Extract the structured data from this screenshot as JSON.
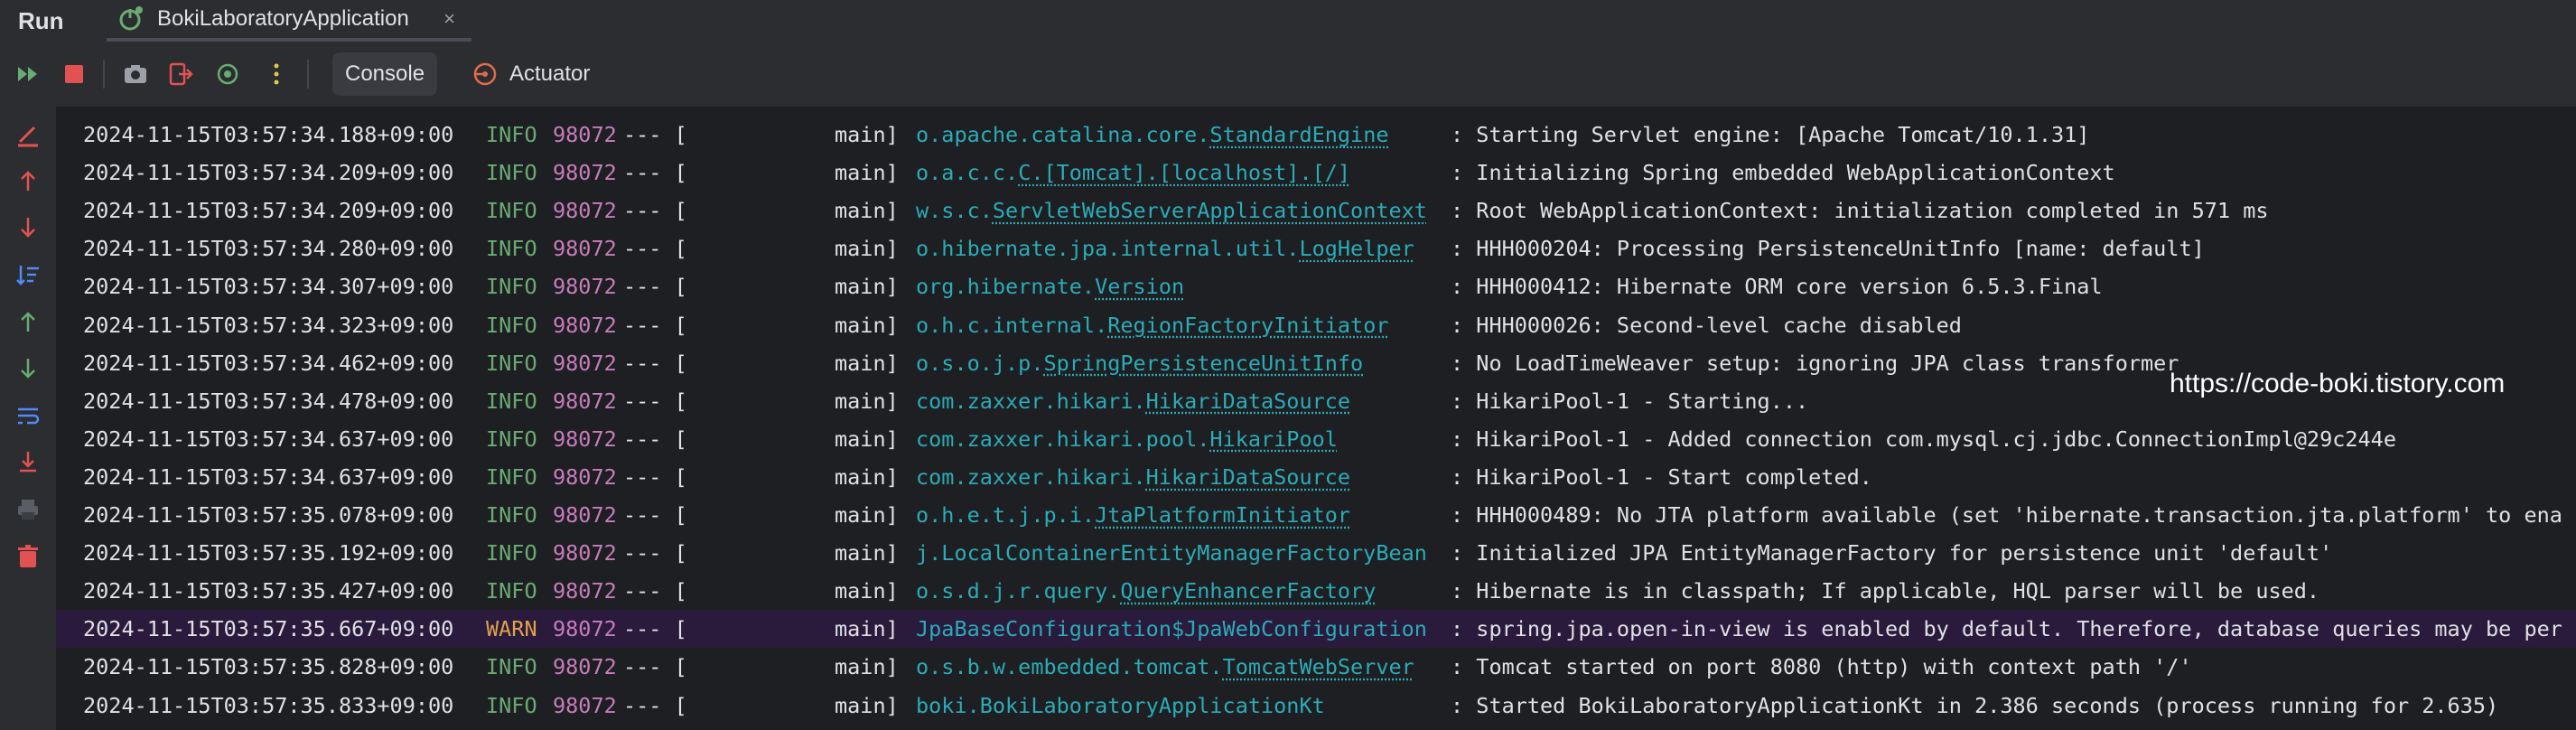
{
  "header": {
    "run_title": "Run",
    "tab_label": "BokiLaboratoryApplication",
    "tab_close": "×"
  },
  "toolbar": {
    "console_label": "Console",
    "actuator_label": "Actuator",
    "icons": [
      "rerun-icon",
      "stop-icon",
      "screenshot-icon",
      "exit-icon",
      "debug-icon",
      "more-icon"
    ]
  },
  "gutter_icons": [
    "clear-icon",
    "up-arrow-icon",
    "down-arrow-icon",
    "sort-icon",
    "up-icon",
    "down-icon",
    "soft-wrap-icon",
    "scroll-to-end-icon",
    "print-icon",
    "trash-icon"
  ],
  "watermark": "https://code-boki.tistory.com",
  "colors": {
    "background": "#1e1f22",
    "panel": "#2b2d30",
    "info": "#6aab73",
    "warn": "#e0a24a",
    "pid": "#c77dbb",
    "logger": "#2aacb8",
    "warn_row_bg": "#2a1a3c"
  },
  "log_rows": [
    {
      "ts": "2024-11-15T03:57:34.188+09:00",
      "level": "INFO",
      "pid": "98072",
      "sep": "--- [",
      "thread": "main]",
      "logger": "o.apache.catalina.core.StandardEngine",
      "logger_prefix": "o.apache.catalina.core.",
      "logger_class": "StandardEngine",
      "msg": ": Starting Servlet engine: [Apache Tomcat/10.1.31]"
    },
    {
      "ts": "2024-11-15T03:57:34.209+09:00",
      "level": "INFO",
      "pid": "98072",
      "sep": "--- [",
      "thread": "main]",
      "logger": "o.a.c.c.C.[Tomcat].[localhost].[/]",
      "logger_prefix": "o.a.c.c.",
      "logger_class": "C.[Tomcat].[localhost].[/]",
      "msg": ": Initializing Spring embedded WebApplicationContext"
    },
    {
      "ts": "2024-11-15T03:57:34.209+09:00",
      "level": "INFO",
      "pid": "98072",
      "sep": "--- [",
      "thread": "main]",
      "logger": "w.s.c.ServletWebServerApplicationContext",
      "logger_prefix": "w.s.c.",
      "logger_class": "ServletWebServerApplicationContext",
      "msg": ": Root WebApplicationContext: initialization completed in 571 ms"
    },
    {
      "ts": "2024-11-15T03:57:34.280+09:00",
      "level": "INFO",
      "pid": "98072",
      "sep": "--- [",
      "thread": "main]",
      "logger": "o.hibernate.jpa.internal.util.LogHelper",
      "logger_prefix": "o.hibernate.jpa.internal.util.",
      "logger_class": "LogHelper",
      "msg": ": HHH000204: Processing PersistenceUnitInfo [name: default]"
    },
    {
      "ts": "2024-11-15T03:57:34.307+09:00",
      "level": "INFO",
      "pid": "98072",
      "sep": "--- [",
      "thread": "main]",
      "logger": "org.hibernate.Version",
      "logger_prefix": "org.hibernate.",
      "logger_class": "Version",
      "msg": ": HHH000412: Hibernate ORM core version 6.5.3.Final"
    },
    {
      "ts": "2024-11-15T03:57:34.323+09:00",
      "level": "INFO",
      "pid": "98072",
      "sep": "--- [",
      "thread": "main]",
      "logger": "o.h.c.internal.RegionFactoryInitiator",
      "logger_prefix": "o.h.c.internal.",
      "logger_class": "RegionFactoryInitiator",
      "msg": ": HHH000026: Second-level cache disabled"
    },
    {
      "ts": "2024-11-15T03:57:34.462+09:00",
      "level": "INFO",
      "pid": "98072",
      "sep": "--- [",
      "thread": "main]",
      "logger": "o.s.o.j.p.SpringPersistenceUnitInfo",
      "logger_prefix": "o.s.o.j.p.",
      "logger_class": "SpringPersistenceUnitInfo",
      "msg": ": No LoadTimeWeaver setup: ignoring JPA class transformer"
    },
    {
      "ts": "2024-11-15T03:57:34.478+09:00",
      "level": "INFO",
      "pid": "98072",
      "sep": "--- [",
      "thread": "main]",
      "logger": "com.zaxxer.hikari.HikariDataSource",
      "logger_prefix": "com.zaxxer.hikari.",
      "logger_class": "HikariDataSource",
      "msg": ": HikariPool-1 - Starting..."
    },
    {
      "ts": "2024-11-15T03:57:34.637+09:00",
      "level": "INFO",
      "pid": "98072",
      "sep": "--- [",
      "thread": "main]",
      "logger": "com.zaxxer.hikari.pool.HikariPool",
      "logger_prefix": "com.zaxxer.hikari.pool.",
      "logger_class": "HikariPool",
      "msg": ": HikariPool-1 - Added connection com.mysql.cj.jdbc.ConnectionImpl@29c244e"
    },
    {
      "ts": "2024-11-15T03:57:34.637+09:00",
      "level": "INFO",
      "pid": "98072",
      "sep": "--- [",
      "thread": "main]",
      "logger": "com.zaxxer.hikari.HikariDataSource",
      "logger_prefix": "com.zaxxer.hikari.",
      "logger_class": "HikariDataSource",
      "msg": ": HikariPool-1 - Start completed."
    },
    {
      "ts": "2024-11-15T03:57:35.078+09:00",
      "level": "INFO",
      "pid": "98072",
      "sep": "--- [",
      "thread": "main]",
      "logger": "o.h.e.t.j.p.i.JtaPlatformInitiator",
      "logger_prefix": "o.h.e.t.j.p.i.",
      "logger_class": "JtaPlatformInitiator",
      "msg": ": HHH000489: No JTA platform available (set 'hibernate.transaction.jta.platform' to ena"
    },
    {
      "ts": "2024-11-15T03:57:35.192+09:00",
      "level": "INFO",
      "pid": "98072",
      "sep": "--- [",
      "thread": "main]",
      "logger": "j.LocalContainerEntityManagerFactoryBean",
      "logger_prefix": "j.LocalContainerEntityManagerFactoryBean",
      "logger_class": "",
      "msg": ": Initialized JPA EntityManagerFactory for persistence unit 'default'"
    },
    {
      "ts": "2024-11-15T03:57:35.427+09:00",
      "level": "INFO",
      "pid": "98072",
      "sep": "--- [",
      "thread": "main]",
      "logger": "o.s.d.j.r.query.QueryEnhancerFactory",
      "logger_prefix": "o.s.d.j.r.query.",
      "logger_class": "QueryEnhancerFactory",
      "msg": ": Hibernate is in classpath; If applicable, HQL parser will be used."
    },
    {
      "ts": "2024-11-15T03:57:35.667+09:00",
      "level": "WARN",
      "pid": "98072",
      "sep": "--- [",
      "thread": "main]",
      "logger": "JpaBaseConfiguration$JpaWebConfiguration",
      "logger_prefix": "JpaBaseConfiguration$JpaWebConfiguration",
      "logger_class": "",
      "msg": ": spring.jpa.open-in-view is enabled by default. Therefore, database queries may be per"
    },
    {
      "ts": "2024-11-15T03:57:35.828+09:00",
      "level": "INFO",
      "pid": "98072",
      "sep": "--- [",
      "thread": "main]",
      "logger": "o.s.b.w.embedded.tomcat.TomcatWebServer",
      "logger_prefix": "o.s.b.w.embedded.tomcat.",
      "logger_class": "TomcatWebServer",
      "msg": ": Tomcat started on port 8080 (http) with context path '/'"
    },
    {
      "ts": "2024-11-15T03:57:35.833+09:00",
      "level": "INFO",
      "pid": "98072",
      "sep": "--- [",
      "thread": "main]",
      "logger": "boki.BokiLaboratoryApplicationKt",
      "logger_prefix": "boki.BokiLaboratoryApplicationKt",
      "logger_class": "",
      "msg": ": Started BokiLaboratoryApplicationKt in 2.386 seconds (process running for 2.635)"
    }
  ]
}
